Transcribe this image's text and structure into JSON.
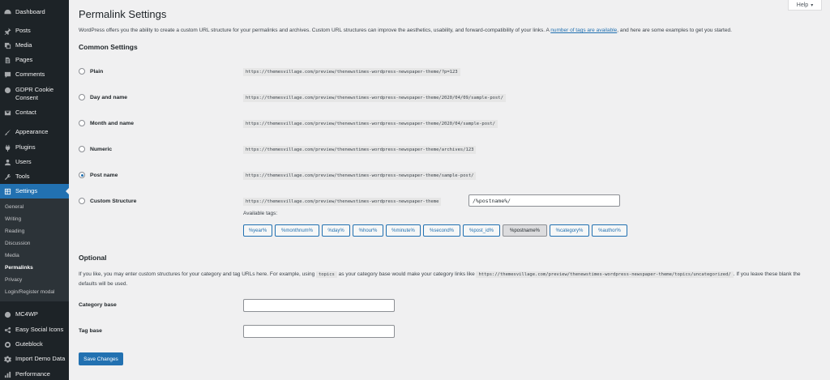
{
  "sidebar": {
    "items": [
      {
        "label": "Dashboard",
        "icon": "dashboard-icon"
      },
      {
        "label": "Posts",
        "icon": "pin-icon"
      },
      {
        "label": "Media",
        "icon": "media-icon"
      },
      {
        "label": "Pages",
        "icon": "pages-icon"
      },
      {
        "label": "Comments",
        "icon": "comments-icon"
      },
      {
        "label": "GDPR Cookie Consent",
        "icon": "cookie-icon"
      },
      {
        "label": "Contact",
        "icon": "envelope-icon"
      },
      {
        "label": "Appearance",
        "icon": "brush-icon"
      },
      {
        "label": "Plugins",
        "icon": "plugin-icon"
      },
      {
        "label": "Users",
        "icon": "user-icon"
      },
      {
        "label": "Tools",
        "icon": "wrench-icon"
      },
      {
        "label": "Settings",
        "icon": "settings-icon"
      },
      {
        "label": "MC4WP",
        "icon": "mc4wp-icon"
      },
      {
        "label": "Easy Social Icons",
        "icon": "social-icon"
      },
      {
        "label": "Guteblock",
        "icon": "guteblock-icon"
      },
      {
        "label": "Import Demo Data",
        "icon": "gear-icon"
      },
      {
        "label": "Performance",
        "icon": "performance-icon"
      }
    ],
    "submenu": [
      "General",
      "Writing",
      "Reading",
      "Discussion",
      "Media",
      "Permalinks",
      "Privacy",
      "Login/Register modal"
    ]
  },
  "help": {
    "label": "Help"
  },
  "page": {
    "title": "Permalink Settings",
    "intro_before": "WordPress offers you the ability to create a custom URL structure for your permalinks and archives. Custom URL structures can improve the aesthetics, usability, and forward-compatibility of your links. A ",
    "intro_link": "number of tags are available",
    "intro_after": ", and here are some examples to get you started."
  },
  "common": {
    "heading": "Common Settings",
    "options": [
      {
        "label": "Plain",
        "example": "https://themesvillage.com/preview/thenewstimes-wordpress-newspaper-theme/?p=123",
        "checked": false
      },
      {
        "label": "Day and name",
        "example": "https://themesvillage.com/preview/thenewstimes-wordpress-newspaper-theme/2020/04/09/sample-post/",
        "checked": false
      },
      {
        "label": "Month and name",
        "example": "https://themesvillage.com/preview/thenewstimes-wordpress-newspaper-theme/2020/04/sample-post/",
        "checked": false
      },
      {
        "label": "Numeric",
        "example": "https://themesvillage.com/preview/thenewstimes-wordpress-newspaper-theme/archives/123",
        "checked": false
      },
      {
        "label": "Post name",
        "example": "https://themesvillage.com/preview/thenewstimes-wordpress-newspaper-theme/sample-post/",
        "checked": true
      },
      {
        "label": "Custom Structure",
        "example": "https://themesvillage.com/preview/thenewstimes-wordpress-newspaper-theme",
        "checked": false
      }
    ],
    "custom_value": "/%postname%/",
    "available_tags_label": "Available tags:",
    "tags": [
      "%year%",
      "%monthnum%",
      "%day%",
      "%hour%",
      "%minute%",
      "%second%",
      "%post_id%",
      "%postname%",
      "%category%",
      "%author%"
    ],
    "active_tag": "%postname%"
  },
  "optional": {
    "heading": "Optional",
    "desc_1": "If you like, you may enter custom structures for your category and tag URLs here. For example, using ",
    "desc_code_1": "topics",
    "desc_2": " as your category base would make your category links like ",
    "desc_code_2": "https://themesvillage.com/preview/thenewstimes-wordpress-newspaper-theme/topics/uncategorized/",
    "desc_3": ". If you leave these blank the defaults will be used.",
    "category_base_label": "Category base",
    "category_base_value": "",
    "tag_base_label": "Tag base",
    "tag_base_value": ""
  },
  "save_label": "Save Changes",
  "colors": {
    "accent": "#2271b1",
    "sidebar": "#1d2327",
    "submenu": "#2c3338"
  }
}
